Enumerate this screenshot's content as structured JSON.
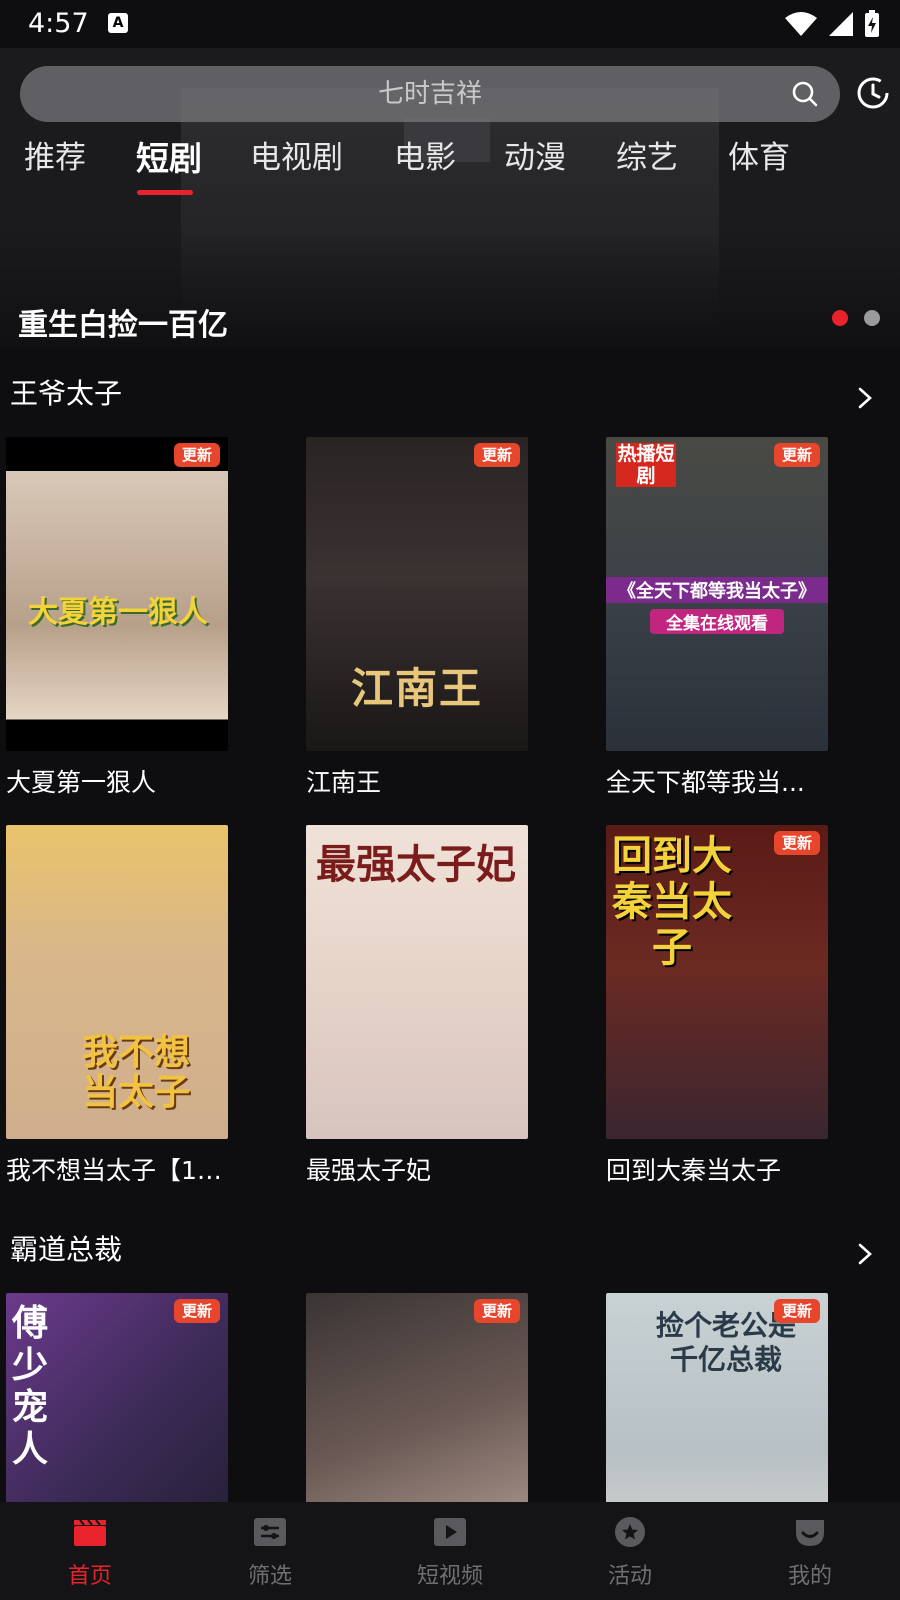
{
  "status_bar": {
    "time": "4:57",
    "notification_letter": "A"
  },
  "search": {
    "placeholder": "七时吉祥"
  },
  "tabs": [
    {
      "label": "推荐",
      "active": false
    },
    {
      "label": "短剧",
      "active": true
    },
    {
      "label": "电视剧",
      "active": false
    },
    {
      "label": "电影",
      "active": false
    },
    {
      "label": "动漫",
      "active": false
    },
    {
      "label": "综艺",
      "active": false
    },
    {
      "label": "体育",
      "active": false
    }
  ],
  "banner": {
    "title": "重生白捡一百亿",
    "pages": 2,
    "current_page": 1
  },
  "sections": [
    {
      "title": "王爷太子",
      "items": [
        {
          "title": "大夏第一狠人",
          "badge": "更新",
          "poster_text": "大夏第一狠人"
        },
        {
          "title": "江南王",
          "badge": "更新",
          "poster_text": "江南王"
        },
        {
          "title": "全天下都等我当...",
          "badge": "更新",
          "poster_text": "《全天下都等我当太子》",
          "poster_sub": "全集在线观看",
          "poster_corner": "热播短剧"
        },
        {
          "title": "我不想当太子【1-...",
          "badge": "",
          "poster_text": "我不想当太子"
        },
        {
          "title": "最强太子妃",
          "badge": "",
          "poster_text": "最强太子妃"
        },
        {
          "title": "回到大秦当太子",
          "badge": "更新",
          "poster_text": "回到大秦当太子"
        }
      ]
    },
    {
      "title": "霸道总裁",
      "items": [
        {
          "title": "",
          "badge": "更新",
          "poster_text": "傅少宠人"
        },
        {
          "title": "",
          "badge": "更新",
          "poster_text": ""
        },
        {
          "title": "",
          "badge": "更新",
          "poster_text": "捡个老公是千亿总裁"
        }
      ]
    }
  ],
  "bottom_nav": [
    {
      "label": "首页",
      "icon": "clapperboard-icon",
      "active": true
    },
    {
      "label": "筛选",
      "icon": "filter-icon",
      "active": false
    },
    {
      "label": "短视频",
      "icon": "play-icon",
      "active": false
    },
    {
      "label": "活动",
      "icon": "star-icon",
      "active": false
    },
    {
      "label": "我的",
      "icon": "profile-icon",
      "active": false
    }
  ],
  "colors": {
    "accent": "#e8232c",
    "badge": "#e8462c",
    "background": "#0e0e10"
  }
}
